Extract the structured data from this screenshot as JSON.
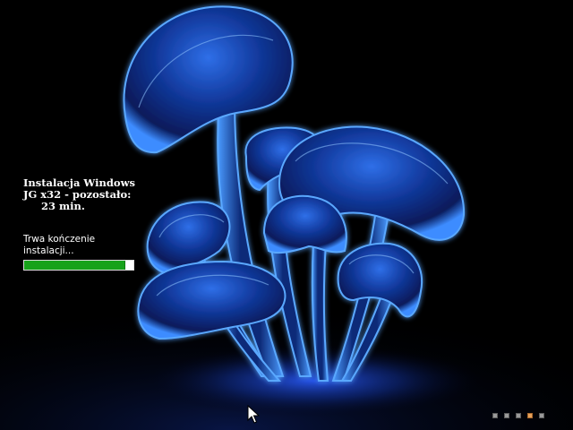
{
  "setup": {
    "title_lines": [
      "Instalacja Windows",
      "JG x32 - pozostało:",
      "23 min."
    ],
    "remaining_minutes": 23,
    "status_lines": [
      "Trwa kończenie",
      "instalacji..."
    ],
    "progress_fraction": 0.93,
    "progress_color": "#17a21a"
  },
  "wallpaper": {
    "subject": "glowing-blue-mushrooms",
    "glow_color": "#3a8bff",
    "background_color": "#000000"
  },
  "pager": {
    "dot_count": 5,
    "active_index": 3,
    "active_color": "#e6a15b",
    "inactive_color": "#9a9a9a"
  },
  "cursor": {
    "icon": "arrow-pointer-icon"
  }
}
